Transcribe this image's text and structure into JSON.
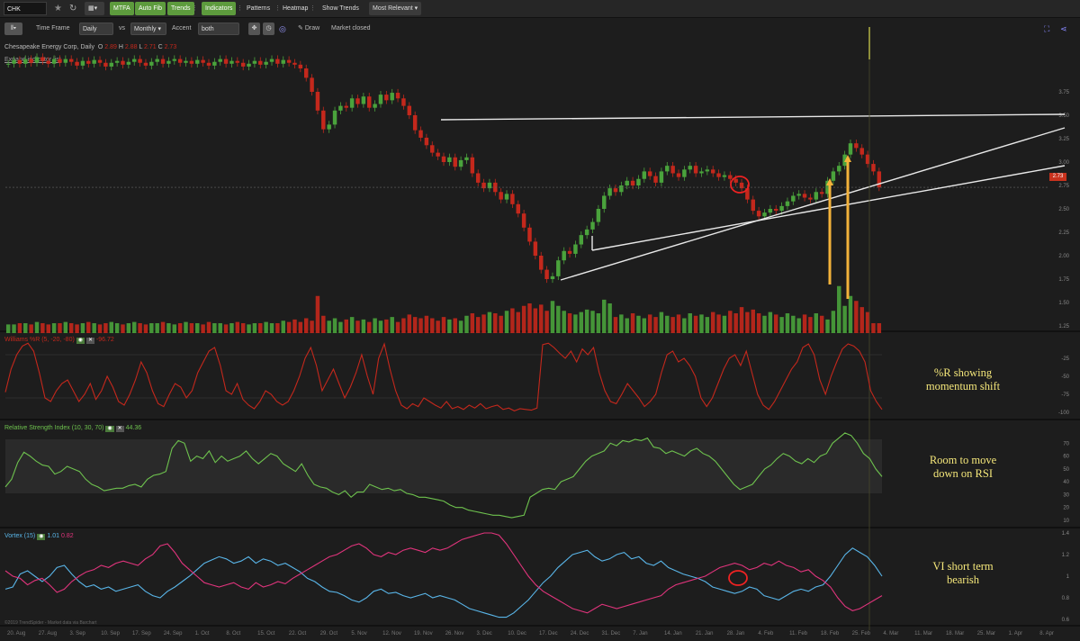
{
  "toolbar": {
    "symbol": "CHK",
    "mtfa": "MTFA",
    "autofib": "Auto Fib",
    "trends": "Trends",
    "indicators": "Indicators",
    "patterns": "Patterns",
    "heatmap": "Heatmap",
    "show_trends": "Show Trends",
    "relevance": "Most Relevant ▾"
  },
  "settings": {
    "time_frame_label": "Time Frame",
    "time_frame": "Daily",
    "vs_label": "vs",
    "compare": "Monthly ▾",
    "accent_label": "Accent",
    "accent": "both",
    "draw": "Draw",
    "market_status": "Market closed"
  },
  "chart_header": {
    "name": "Chesapeake Energy Corp, Daily",
    "ohlc": [
      {
        "k": "O",
        "v": "2.89"
      },
      {
        "k": "H",
        "v": "2.88"
      },
      {
        "k": "L",
        "v": "2.71"
      },
      {
        "k": "C",
        "v": "2.73"
      }
    ],
    "expand": "Expand indicator list"
  },
  "price_tag": "2.73",
  "indicators": {
    "willr_label": "Williams %R (5, -20, -80)",
    "willr_value": "-96.72",
    "rsi_label": "Relative Strength Index (10, 30, 70)",
    "rsi_value": "44.36",
    "vortex_label": "Vortex (15)",
    "vortex_plus": "1.01",
    "vortex_minus": "0.82",
    "copyright": "©2019 TrendSpider - Market data via Barchart"
  },
  "annotations": {
    "willr": [
      "%R showing",
      "momentum shift"
    ],
    "rsi": [
      "Room to move",
      "down on RSI"
    ],
    "vortex": [
      "VI short term",
      "bearish"
    ]
  },
  "colors": {
    "up": "#4aa33c",
    "down": "#c4281c",
    "rsi": "#6ec24e",
    "vi_plus": "#59b5e8",
    "vi_minus": "#e0347c",
    "arrow": "#f3b23a"
  },
  "chart_data": [
    {
      "type": "candlestick",
      "y_ticks": [
        "3.75",
        "3.50",
        "3.25",
        "3.00",
        "2.75",
        "2.50",
        "2.25",
        "2.00",
        "1.75",
        "1.50",
        "1.25"
      ],
      "ylim": [
        1.25,
        4.25
      ],
      "last": 2.73,
      "closes": [
        4.05,
        4.09,
        4.05,
        4.1,
        4.06,
        4.12,
        4.08,
        4.05,
        4.1,
        4.06,
        4.1,
        4.07,
        4.03,
        4.08,
        4.05,
        4.09,
        4.06,
        4.02,
        4.06,
        4.08,
        4.04,
        4.07,
        4.1,
        4.06,
        4.03,
        4.07,
        4.1,
        4.05,
        4.08,
        4.1,
        4.06,
        4.08,
        4.05,
        4.09,
        4.06,
        4.03,
        4.07,
        4.1,
        4.05,
        4.08,
        4.06,
        4.02,
        4.05,
        4.08,
        4.04,
        4.07,
        4.1,
        4.05,
        4.09,
        4.06,
        4.04,
        4.0,
        3.9,
        3.75,
        3.55,
        3.35,
        3.4,
        3.55,
        3.6,
        3.58,
        3.68,
        3.62,
        3.7,
        3.58,
        3.62,
        3.72,
        3.66,
        3.74,
        3.68,
        3.6,
        3.5,
        3.34,
        3.26,
        3.18,
        3.1,
        3.06,
        3.0,
        3.05,
        2.95,
        3.02,
        3.05,
        2.88,
        2.78,
        2.72,
        2.78,
        2.68,
        2.6,
        2.66,
        2.55,
        2.45,
        2.3,
        2.15,
        2.0,
        1.85,
        1.75,
        1.78,
        1.95,
        2.05,
        2.02,
        2.12,
        2.22,
        2.28,
        2.36,
        2.5,
        2.64,
        2.72,
        2.68,
        2.75,
        2.8,
        2.75,
        2.82,
        2.9,
        2.85,
        2.78,
        2.9,
        2.96,
        2.88,
        2.84,
        2.92,
        2.96,
        2.88,
        2.9,
        2.92,
        2.88,
        2.84,
        2.86,
        2.82,
        2.78,
        2.72,
        2.6,
        2.48,
        2.42,
        2.46,
        2.5,
        2.48,
        2.53,
        2.58,
        2.64,
        2.66,
        2.62,
        2.6,
        2.68,
        2.66,
        2.8,
        2.9,
        2.96,
        3.08,
        3.2,
        3.15,
        3.08,
        2.98,
        2.9,
        2.73
      ]
    },
    {
      "type": "bar",
      "name": "volume",
      "values": [
        7,
        7,
        8,
        8,
        7,
        9,
        8,
        7,
        8,
        8,
        9,
        8,
        7,
        8,
        9,
        8,
        7,
        8,
        9,
        8,
        7,
        8,
        9,
        8,
        7,
        8,
        8,
        9,
        8,
        7,
        8,
        9,
        8,
        8,
        7,
        9,
        8,
        8,
        7,
        8,
        9,
        8,
        7,
        8,
        8,
        9,
        8,
        8,
        10,
        9,
        11,
        9,
        12,
        10,
        30,
        14,
        10,
        12,
        9,
        11,
        13,
        10,
        11,
        9,
        12,
        10,
        11,
        13,
        9,
        12,
        15,
        13,
        12,
        14,
        12,
        10,
        13,
        11,
        12,
        10,
        14,
        16,
        13,
        15,
        17,
        16,
        14,
        18,
        20,
        17,
        22,
        24,
        20,
        23,
        18,
        26,
        22,
        18,
        16,
        15,
        17,
        19,
        18,
        16,
        27,
        24,
        13,
        15,
        12,
        16,
        14,
        12,
        15,
        13,
        17,
        14,
        13,
        15,
        12,
        16,
        14,
        15,
        13,
        17,
        15,
        14,
        18,
        16,
        21,
        17,
        19,
        16,
        14,
        17,
        15,
        13,
        16,
        14,
        12,
        15,
        13,
        16,
        14,
        11,
        18,
        38,
        22,
        30,
        26,
        21,
        17
      ]
    },
    {
      "type": "line",
      "name": "williams_r",
      "y_ticks": [
        "-25",
        "-50",
        "-75",
        "-100"
      ],
      "ylim": [
        -100,
        0
      ],
      "values": [
        -72,
        -40,
        -20,
        -8,
        -4,
        -15,
        -45,
        -80,
        -85,
        -70,
        -60,
        -55,
        -70,
        -85,
        -75,
        -60,
        -82,
        -70,
        -50,
        -65,
        -85,
        -90,
        -75,
        -55,
        -30,
        -45,
        -70,
        -88,
        -92,
        -75,
        -60,
        -65,
        -80,
        -70,
        -45,
        -30,
        -15,
        -10,
        -35,
        -70,
        -75,
        -60,
        -82,
        -90,
        -95,
        -85,
        -70,
        -75,
        -85,
        -90,
        -85,
        -70,
        -50,
        -25,
        -10,
        -35,
        -70,
        -55,
        -40,
        -60,
        -80,
        -65,
        -45,
        -20,
        -50,
        -75,
        -25,
        -5,
        -40,
        -70,
        -90,
        -95,
        -88,
        -92,
        -80,
        -85,
        -90,
        -94,
        -85,
        -95,
        -92,
        -96,
        -90,
        -94,
        -88,
        -95,
        -92,
        -90,
        -96,
        -94,
        -98,
        -95,
        -96,
        -97,
        -94,
        -6,
        -4,
        -10,
        -18,
        -25,
        -15,
        -30,
        -12,
        -20,
        -10,
        -45,
        -70,
        -85,
        -88,
        -75,
        -60,
        -70,
        -80,
        -92,
        -85,
        -75,
        -45,
        -20,
        -15,
        -30,
        -25,
        -35,
        -50,
        -80,
        -92,
        -80,
        -60,
        -40,
        -25,
        -20,
        -35,
        -15,
        -45,
        -75,
        -90,
        -96,
        -85,
        -70,
        -55,
        -40,
        -30,
        -10,
        -5,
        -20,
        -55,
        -75,
        -50,
        -30,
        -12,
        -5,
        -8,
        -15,
        -30,
        -70,
        -85,
        -96
      ]
    },
    {
      "type": "line",
      "name": "rsi",
      "y_ticks": [
        "70",
        "60",
        "50",
        "40",
        "30",
        "20",
        "10"
      ],
      "ylim": [
        10,
        80
      ],
      "values": [
        36,
        42,
        55,
        63,
        60,
        56,
        53,
        52,
        46,
        48,
        52,
        50,
        48,
        42,
        38,
        36,
        33,
        34,
        35,
        35,
        37,
        38,
        36,
        42,
        45,
        46,
        48,
        66,
        72,
        70,
        56,
        60,
        58,
        64,
        55,
        60,
        56,
        58,
        60,
        64,
        58,
        54,
        58,
        62,
        60,
        54,
        51,
        48,
        54,
        45,
        38,
        36,
        35,
        32,
        30,
        33,
        28,
        32,
        32,
        38,
        36,
        34,
        35,
        33,
        34,
        31,
        30,
        28,
        28,
        27,
        26,
        25,
        22,
        20,
        20,
        18,
        17,
        16,
        15,
        14,
        14,
        13,
        12,
        13,
        14,
        28,
        31,
        34,
        35,
        34,
        40,
        42,
        44,
        50,
        56,
        60,
        62,
        64,
        70,
        68,
        72,
        71,
        73,
        72,
        74,
        67,
        66,
        62,
        64,
        62,
        60,
        64,
        66,
        62,
        60,
        56,
        50,
        44,
        38,
        34,
        36,
        38,
        44,
        50,
        53,
        58,
        62,
        60,
        56,
        54,
        58,
        55,
        60,
        62,
        70,
        74,
        78,
        76,
        70,
        62,
        58,
        50,
        44
      ]
    },
    {
      "type": "line",
      "name": "vi_plus",
      "y_ticks": [
        "1.4",
        "1.2",
        "1",
        "0.8",
        "0.6"
      ],
      "ylim": [
        0.6,
        1.4
      ],
      "values": [
        0.88,
        0.9,
        1.02,
        1.05,
        1.0,
        0.95,
        1.0,
        1.08,
        1.1,
        1.02,
        0.95,
        0.9,
        0.92,
        0.88,
        0.9,
        0.86,
        0.88,
        0.9,
        0.92,
        0.86,
        0.82,
        0.8,
        0.86,
        0.9,
        0.95,
        1.0,
        1.06,
        1.12,
        1.15,
        1.18,
        1.16,
        1.12,
        1.14,
        1.18,
        1.12,
        1.16,
        1.14,
        1.1,
        1.12,
        1.08,
        1.04,
        0.98,
        0.95,
        0.9,
        0.86,
        0.85,
        0.82,
        0.78,
        0.76,
        0.8,
        0.86,
        0.88,
        0.84,
        0.85,
        0.82,
        0.8,
        0.82,
        0.84,
        0.8,
        0.82,
        0.8,
        0.78,
        0.74,
        0.7,
        0.68,
        0.66,
        0.64,
        0.62,
        0.62,
        0.66,
        0.72,
        0.78,
        0.86,
        0.94,
        1.0,
        1.08,
        1.14,
        1.2,
        1.22,
        1.24,
        1.18,
        1.14,
        1.16,
        1.2,
        1.22,
        1.16,
        1.18,
        1.12,
        1.1,
        1.14,
        1.08,
        1.05,
        1.02,
        1.0,
        0.98,
        0.95,
        0.9,
        0.88,
        0.86,
        0.84,
        0.86,
        0.9,
        0.88,
        0.82,
        0.8,
        0.78,
        0.82,
        0.86,
        0.88,
        0.86,
        0.9,
        0.92,
        1.0,
        1.1,
        1.2,
        1.26,
        1.22,
        1.18,
        1.1,
        1.0
      ]
    },
    {
      "type": "line",
      "name": "vi_minus",
      "values": [
        1.05,
        1.0,
        0.98,
        0.92,
        0.96,
        0.98,
        0.92,
        0.85,
        0.88,
        0.95,
        1.0,
        1.04,
        1.06,
        1.1,
        1.08,
        1.12,
        1.14,
        1.12,
        1.1,
        1.16,
        1.2,
        1.28,
        1.3,
        1.22,
        1.12,
        1.06,
        1.0,
        0.94,
        0.92,
        0.9,
        0.92,
        0.94,
        0.9,
        0.88,
        0.94,
        0.9,
        0.92,
        0.95,
        0.93,
        0.98,
        1.02,
        1.06,
        1.1,
        1.14,
        1.18,
        1.2,
        1.24,
        1.28,
        1.3,
        1.26,
        1.2,
        1.18,
        1.22,
        1.2,
        1.24,
        1.26,
        1.24,
        1.22,
        1.26,
        1.24,
        1.26,
        1.3,
        1.34,
        1.36,
        1.38,
        1.4,
        1.4,
        1.38,
        1.3,
        1.2,
        1.1,
        1.0,
        0.92,
        0.86,
        0.82,
        0.78,
        0.74,
        0.7,
        0.68,
        0.66,
        0.7,
        0.74,
        0.72,
        0.7,
        0.72,
        0.74,
        0.76,
        0.78,
        0.8,
        0.82,
        0.88,
        0.92,
        0.94,
        0.96,
        0.98,
        1.0,
        1.04,
        1.08,
        1.1,
        1.12,
        1.1,
        1.06,
        1.08,
        1.12,
        1.1,
        1.14,
        1.1,
        1.08,
        1.04,
        1.06,
        1.0,
        0.96,
        0.9,
        0.8,
        0.72,
        0.68,
        0.7,
        0.74,
        0.78,
        0.82
      ]
    }
  ],
  "x_axis": [
    "20. Aug",
    "27. Aug",
    "3. Sep",
    "10. Sep",
    "17. Sep",
    "24. Sep",
    "1. Oct",
    "8. Oct",
    "15. Oct",
    "22. Oct",
    "29. Oct",
    "5. Nov",
    "12. Nov",
    "19. Nov",
    "26. Nov",
    "3. Dec",
    "10. Dec",
    "17. Dec",
    "24. Dec",
    "31. Dec",
    "7. Jan",
    "14. Jan",
    "21. Jan",
    "28. Jan",
    "4. Feb",
    "11. Feb",
    "18. Feb",
    "25. Feb",
    "4. Mar",
    "11. Mar",
    "18. Mar",
    "25. Mar",
    "1. Apr",
    "8. Apr"
  ]
}
